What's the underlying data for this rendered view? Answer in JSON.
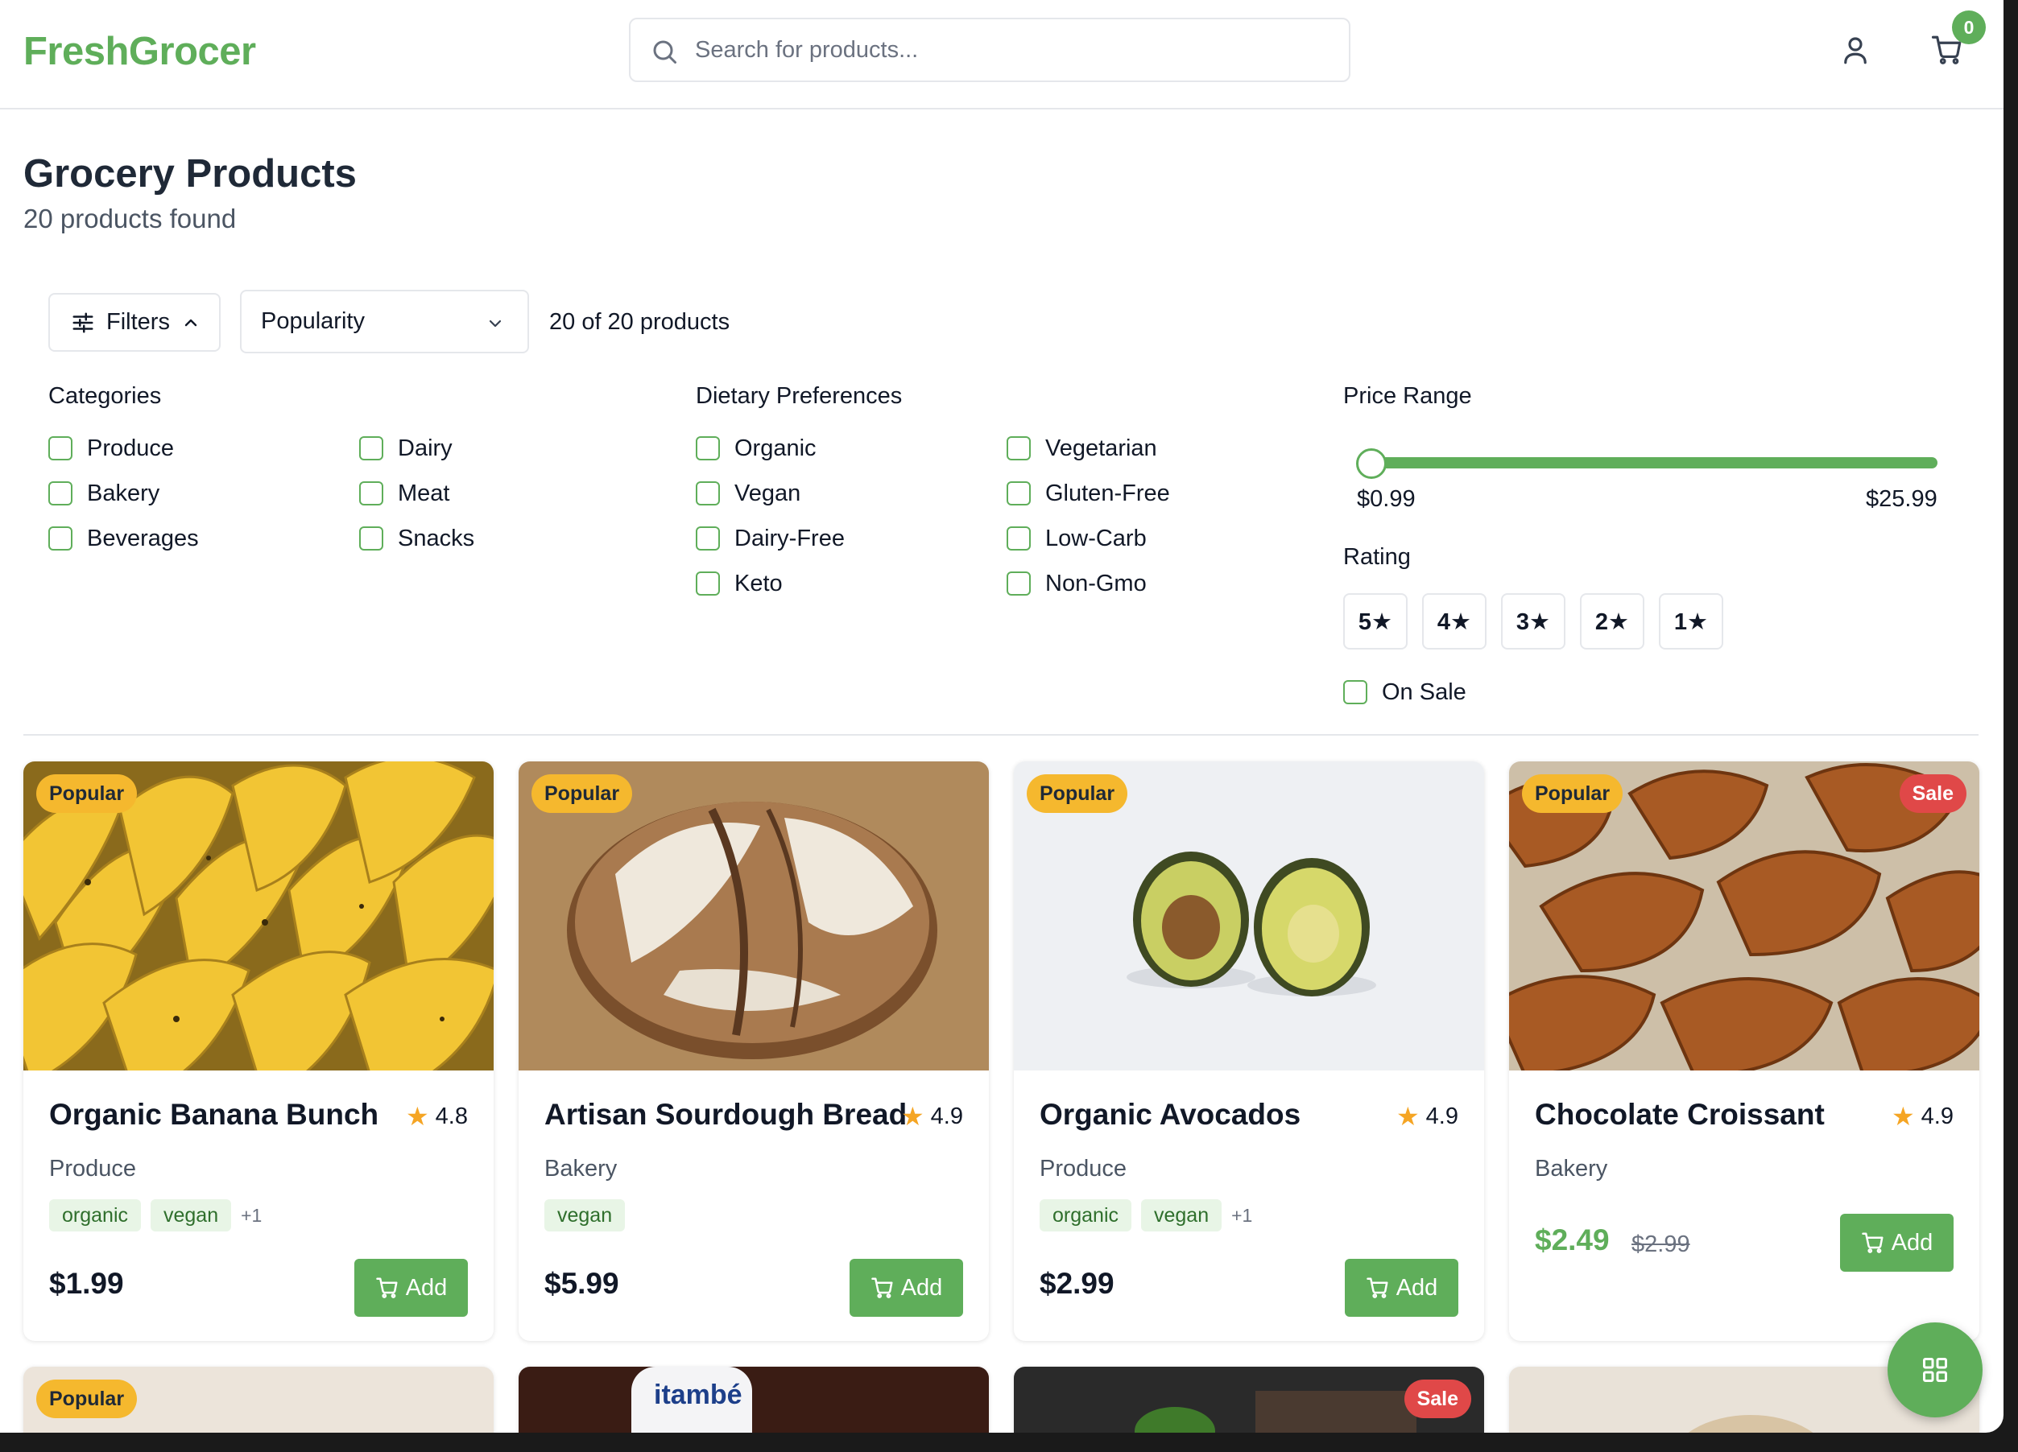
{
  "brand": {
    "name": "FreshGrocer",
    "accent": "#5fae5a"
  },
  "header": {
    "search_placeholder": "Search for products...",
    "cart_count": "0",
    "icons": [
      "search-icon",
      "user-icon",
      "cart-icon"
    ]
  },
  "page": {
    "title": "Grocery Products",
    "count_text": "20 products found"
  },
  "toolbar": {
    "filters_label": "Filters",
    "sort_value": "Popularity",
    "shown_text": "20 of 20 products"
  },
  "filters": {
    "categories": {
      "title": "Categories",
      "items": [
        "Produce",
        "Dairy",
        "Bakery",
        "Meat",
        "Beverages",
        "Snacks"
      ]
    },
    "dietary": {
      "title": "Dietary Preferences",
      "items": [
        "Organic",
        "Vegetarian",
        "Vegan",
        "Gluten-Free",
        "Dairy-Free",
        "Low-Carb",
        "Keto",
        "Non-Gmo"
      ]
    },
    "price": {
      "title": "Price Range",
      "min_label": "$0.99",
      "max_label": "$25.99",
      "min": 0.99,
      "max": 25.99,
      "selected_min": 0.99,
      "selected_max": 25.99
    },
    "rating": {
      "title": "Rating",
      "options": [
        "5★",
        "4★",
        "3★",
        "2★",
        "1★"
      ]
    },
    "on_sale_label": "On Sale"
  },
  "products": [
    {
      "name": "Organic Banana Bunch",
      "rating": "4.8",
      "category": "Produce",
      "badge": "Popular",
      "tags": [
        "organic",
        "vegan"
      ],
      "more": "+1",
      "price": "$1.99",
      "add_label": "Add"
    },
    {
      "name": "Artisan Sourdough Bread",
      "rating": "4.9",
      "category": "Bakery",
      "badge": "Popular",
      "tags": [
        "vegan"
      ],
      "more": "",
      "price": "$5.99",
      "add_label": "Add"
    },
    {
      "name": "Organic Avocados",
      "rating": "4.9",
      "category": "Produce",
      "badge": "Popular",
      "tags": [
        "organic",
        "vegan"
      ],
      "more": "+1",
      "price": "$2.99",
      "add_label": "Add"
    },
    {
      "name": "Chocolate Croissant",
      "rating": "4.9",
      "category": "Bakery",
      "badge": "Popular",
      "sale_badge": "Sale",
      "tags": [],
      "more": "",
      "price": "$2.49",
      "old_price": "$2.99",
      "add_label": "Add"
    }
  ],
  "next_row": [
    {
      "badge": "Popular"
    },
    {
      "label_text": "itambé"
    },
    {
      "badge": "Sale"
    },
    {}
  ]
}
